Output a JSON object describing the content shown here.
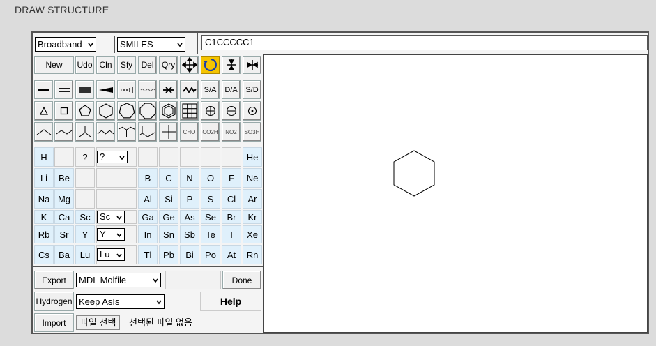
{
  "page_title": "DRAW STRUCTURE",
  "toolbar": {
    "mode_select": "Broadband",
    "format_select": "SMILES",
    "smiles_value": "C1CCCCC1"
  },
  "buttons": {
    "new": "New",
    "undo": "Udo",
    "clean": "Cln",
    "simplify": "Sfy",
    "delete": "Del",
    "query": "Qry"
  },
  "bond_labels": {
    "sa": "S/A",
    "da": "D/A",
    "sd": "S/D"
  },
  "group_labels": {
    "cho": "CHO",
    "co2h": "CO2H",
    "no2": "NO2",
    "so3h": "SO3H"
  },
  "elements": {
    "row1": [
      "H",
      "?",
      "He"
    ],
    "row1_select": "?",
    "row2": [
      "Li",
      "Be",
      "B",
      "C",
      "N",
      "O",
      "F",
      "Ne"
    ],
    "row3": [
      "Na",
      "Mg",
      "Al",
      "Si",
      "P",
      "S",
      "Cl",
      "Ar"
    ],
    "row4": [
      "K",
      "Ca",
      "Sc",
      "Ga",
      "Ge",
      "As",
      "Se",
      "Br",
      "Kr"
    ],
    "row4_select": "Sc",
    "row5": [
      "Rb",
      "Sr",
      "Y",
      "In",
      "Sn",
      "Sb",
      "Te",
      "I",
      "Xe"
    ],
    "row5_select": "Y",
    "row6": [
      "Cs",
      "Ba",
      "Lu",
      "Tl",
      "Pb",
      "Bi",
      "Po",
      "At",
      "Rn"
    ],
    "row6_select": "Lu"
  },
  "bottom": {
    "export": "Export",
    "export_format": "MDL Molfile",
    "done": "Done",
    "hydrogen": "Hydrogen",
    "hydrogen_mode": "Keep AsIs",
    "help": "Help",
    "import": "Import",
    "file_button": "파일 선택",
    "file_status": "선택된 파일 없음"
  },
  "colors": {
    "element_bg": "#dff0fb",
    "active_tool": "#f5c400"
  }
}
